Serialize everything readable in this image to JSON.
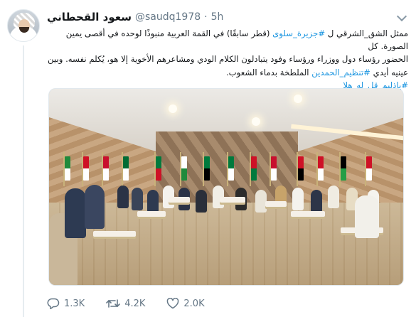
{
  "tweet": {
    "display_name": "سعود القحطاني",
    "screen_name": "@saudq1978",
    "separator": "·",
    "time": "5h",
    "text_lines": [
      {
        "before": "ممثل الشق_الشرقي ل ",
        "link": "#جزيرة_سلوى",
        "after": " (قطر سابقًا) في القمة العربية منبوذًا لوحده في أقصى يمين الصورة. كل"
      },
      {
        "text": "الحضور رؤساء دول ووزراء ورؤساء وفود يتبادلون الكلام الودي ومشاعرهم الأخوية إلا هو، يُكلم نفسه. وبين"
      },
      {
        "before": "عينيه أيدي ",
        "link": "#تنظيم_الحمدين",
        "after": " الملطخة بدماء الشعوب."
      },
      {
        "link": "#ياذليم_قل_له_هلا"
      }
    ]
  },
  "actions": {
    "replies": "1.3K",
    "retweets": "4.2K",
    "likes": "2.0K"
  },
  "colors": {
    "link": "#1b95e0",
    "muted": "#657786",
    "text": "#14171a"
  },
  "icons": {
    "reply": "speech-bubble",
    "retweet": "loop-arrows",
    "like": "heart",
    "menu": "chevron-down"
  }
}
